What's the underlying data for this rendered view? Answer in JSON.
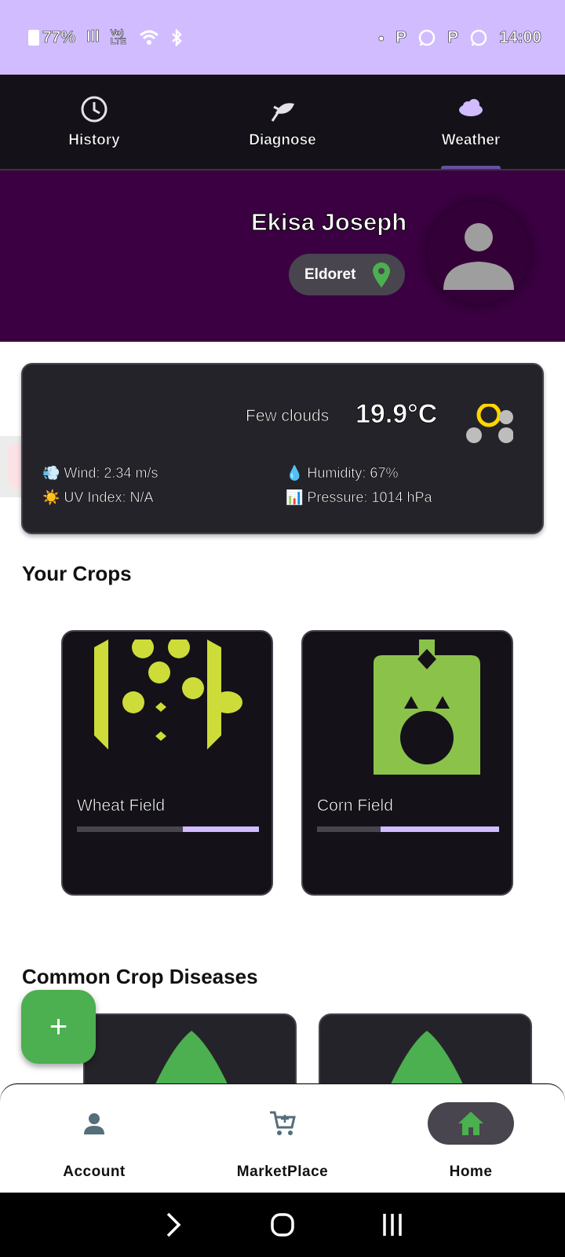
{
  "status_bar": {
    "battery": "77%",
    "time": "14:00",
    "signal_text": "Vo) LTE"
  },
  "top_nav": {
    "items": [
      {
        "label": "History",
        "icon": "clock-icon",
        "active": false
      },
      {
        "label": "Diagnose",
        "icon": "plant-leaf-icon",
        "active": false
      },
      {
        "label": "Weather",
        "icon": "cloud-icon",
        "active": true
      }
    ]
  },
  "profile": {
    "name": "Ekisa Joseph",
    "location": "Eldoret",
    "location_icon": "map-pin-icon",
    "avatar_icon": "person-icon"
  },
  "weather": {
    "condition": "Few clouds",
    "temperature": "19.9°C",
    "wind": "💨 Wind: 2.34 m/s",
    "humidity": "💧 Humidity: 67%",
    "uv_index": "☀️ UV Index: N/A",
    "pressure": "📊 Pressure: 1014 hPa"
  },
  "sections": {
    "crops_title": "Your Crops",
    "diseases_title": "Common Crop Diseases"
  },
  "crops": [
    {
      "name": "Wheat Field",
      "progress": 0.58,
      "image": "wheat-illustration"
    },
    {
      "name": "Corn Field",
      "progress": 0.35,
      "image": "corn-illustration"
    }
  ],
  "fab": {
    "label": "+"
  },
  "bottom_nav": {
    "items": [
      {
        "label": "Account",
        "icon": "person-icon",
        "active": false
      },
      {
        "label": "MarketPlace",
        "icon": "cart-icon",
        "active": false
      },
      {
        "label": "Home",
        "icon": "home-icon",
        "active": true
      }
    ]
  },
  "colors": {
    "status_bar": "#d0bcff",
    "profile_bg": "#3b0042",
    "card_bg": "#25232a",
    "accent_green": "#4caf50",
    "lime": "#cddc39"
  }
}
